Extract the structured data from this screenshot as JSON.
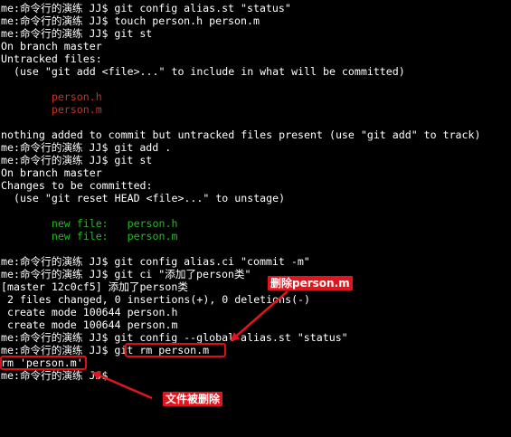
{
  "terminal": {
    "lines": [
      {
        "text": "me:命令行的演练 JJ$ git config alias.st \"status\"",
        "tone": "default"
      },
      {
        "text": "me:命令行的演练 JJ$ touch person.h person.m",
        "tone": "default"
      },
      {
        "text": "me:命令行的演练 JJ$ git st",
        "tone": "default"
      },
      {
        "text": "On branch master",
        "tone": "default"
      },
      {
        "text": "Untracked files:",
        "tone": "default"
      },
      {
        "text": "  (use \"git add <file>...\" to include in what will be committed)",
        "tone": "default"
      },
      {
        "text": "",
        "tone": "default"
      },
      {
        "text": "        person.h",
        "tone": "red"
      },
      {
        "text": "        person.m",
        "tone": "red"
      },
      {
        "text": "",
        "tone": "default"
      },
      {
        "text": "nothing added to commit but untracked files present (use \"git add\" to track)",
        "tone": "default"
      },
      {
        "text": "me:命令行的演练 JJ$ git add .",
        "tone": "default"
      },
      {
        "text": "me:命令行的演练 JJ$ git st",
        "tone": "default"
      },
      {
        "text": "On branch master",
        "tone": "default"
      },
      {
        "text": "Changes to be committed:",
        "tone": "default"
      },
      {
        "text": "  (use \"git reset HEAD <file>...\" to unstage)",
        "tone": "default"
      },
      {
        "text": "",
        "tone": "default"
      },
      {
        "text": "        new file:   person.h",
        "tone": "green"
      },
      {
        "text": "        new file:   person.m",
        "tone": "green"
      },
      {
        "text": "",
        "tone": "default"
      },
      {
        "text": "me:命令行的演练 JJ$ git config alias.ci \"commit -m\"",
        "tone": "default"
      },
      {
        "text": "me:命令行的演练 JJ$ git ci \"添加了person类\"",
        "tone": "default"
      },
      {
        "text": "[master 12c0cf5] 添加了person类",
        "tone": "default"
      },
      {
        "text": " 2 files changed, 0 insertions(+), 0 deletions(-)",
        "tone": "default"
      },
      {
        "text": " create mode 100644 person.h",
        "tone": "default"
      },
      {
        "text": " create mode 100644 person.m",
        "tone": "default"
      },
      {
        "text": "me:命令行的演练 JJ$ git config --global alias.st \"status\"",
        "tone": "default"
      },
      {
        "text": "me:命令行的演练 JJ$ git rm person.m",
        "tone": "default"
      },
      {
        "text": "rm 'person.m'",
        "tone": "default"
      },
      {
        "text": "me:命令行的演练 JJ$",
        "tone": "default"
      }
    ]
  },
  "annotations": {
    "delete_label": "删除person.m",
    "deleted_label": "文件被删除"
  },
  "colors": {
    "background": "#000000",
    "text": "#ffffff",
    "untracked": "#c23621",
    "staged": "#25bc24",
    "annotation": "#e0161e"
  }
}
